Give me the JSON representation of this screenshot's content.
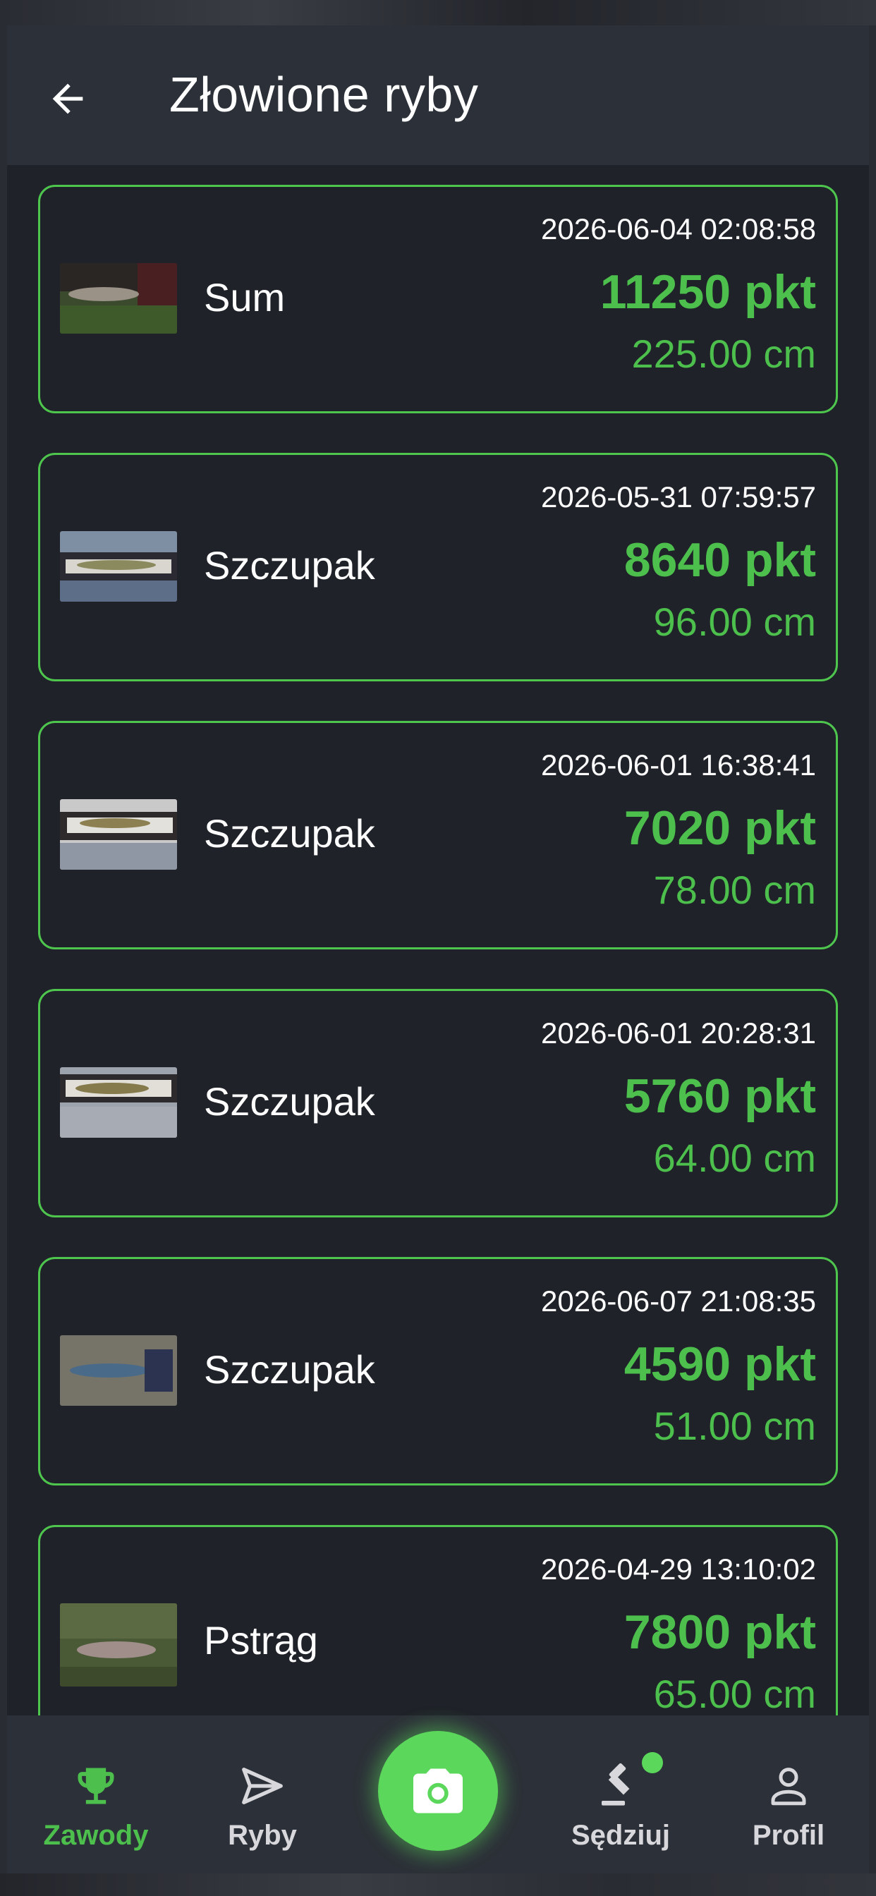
{
  "header": {
    "title": "Złowione ryby",
    "back_icon": "arrow-left-icon"
  },
  "accent_color": "#4cbf4c",
  "catches": [
    {
      "name": "Sum",
      "datetime": "2026-06-04 02:08:58",
      "points": "11250 pkt",
      "length": "225.00 cm"
    },
    {
      "name": "Szczupak",
      "datetime": "2026-05-31 07:59:57",
      "points": "8640 pkt",
      "length": "96.00 cm"
    },
    {
      "name": "Szczupak",
      "datetime": "2026-06-01 16:38:41",
      "points": "7020 pkt",
      "length": "78.00 cm"
    },
    {
      "name": "Szczupak",
      "datetime": "2026-06-01 20:28:31",
      "points": "5760 pkt",
      "length": "64.00 cm"
    },
    {
      "name": "Szczupak",
      "datetime": "2026-06-07 21:08:35",
      "points": "4590 pkt",
      "length": "51.00 cm"
    },
    {
      "name": "Pstrąg",
      "datetime": "2026-04-29 13:10:02",
      "points": "7800 pkt",
      "length": "65.00 cm"
    }
  ],
  "bottom_nav": {
    "items": [
      {
        "label": "Zawody",
        "icon": "trophy-icon",
        "active": true
      },
      {
        "label": "Ryby",
        "icon": "send-icon",
        "active": false
      },
      {
        "label": "",
        "icon": "camera-icon",
        "active": false
      },
      {
        "label": "Sędziuj",
        "icon": "gavel-icon",
        "active": false
      },
      {
        "label": "Profil",
        "icon": "person-icon",
        "active": false
      }
    ]
  }
}
